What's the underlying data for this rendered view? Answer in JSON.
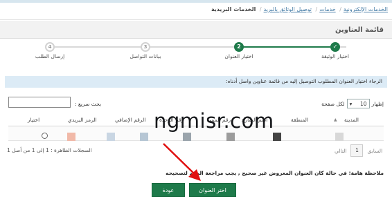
{
  "breadcrumb": {
    "items": [
      "الخدمات الإلكترونية",
      "خدمات",
      "توصيل الوثائق بالبريد",
      "الخدمات البريدية"
    ],
    "separator": "/"
  },
  "panel": {
    "title": "قائمة العناوين"
  },
  "stepper": {
    "steps": [
      {
        "number": "✓",
        "label": "اختيار الوثيقة",
        "state": "done"
      },
      {
        "number": "2",
        "label": "اختيار العنوان",
        "state": "active"
      },
      {
        "number": "3",
        "label": "بيانات التواصل",
        "state": "todo"
      },
      {
        "number": "4",
        "label": "إرسال الطلب",
        "state": "todo"
      }
    ],
    "accent_color": "#1e7a4a"
  },
  "info": {
    "text": "الرجاء اختيار العنوان المطلوب التوصيل إليه من قائمة عناوين واصل أدناه:"
  },
  "table_controls": {
    "show_prefix": "إظهار",
    "page_size": "10",
    "show_suffix": "لكل صفحة",
    "search_label": "بحث سريع :",
    "search_value": ""
  },
  "table": {
    "columns": [
      "المدينة",
      "المنطقة",
      "اسم الشارع",
      "رقم المبنى",
      "رقم الوحدة",
      "الرقم الإضافي",
      "الرمز البريدي",
      "اختيار"
    ],
    "row_swatch_colors": [
      "#d8d8d8",
      "#444444",
      "#9c9c9c",
      "#9aa4ac",
      "#b6c6d4",
      "#c9d6e3",
      "#f1b9a8"
    ]
  },
  "pagination": {
    "previous": "السابق",
    "page": "1",
    "next": "التالي",
    "records_text": "السجلات الظاهرة : 1 إلى 1 من أصل 1"
  },
  "note": {
    "text": "ملاحظة هامة: في حالة كان العنوان المعروض غير صحيح , يجب مراجعة البريد لتصحيحه"
  },
  "buttons": {
    "choose": "اختر العنوان",
    "back": "عودة"
  },
  "watermark": {
    "text": "ngmisr.com"
  },
  "annotation": {
    "arrow_color": "#e01010"
  }
}
